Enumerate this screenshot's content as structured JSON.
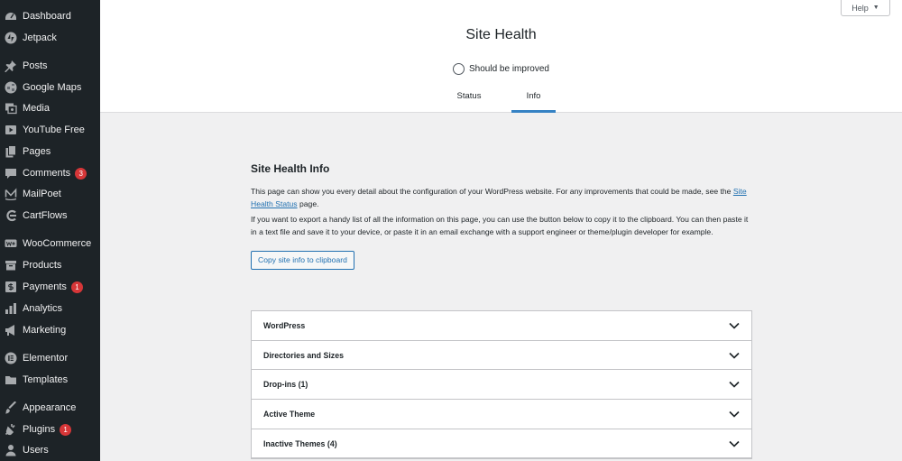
{
  "sidebar": {
    "items": [
      {
        "label": "Dashboard",
        "icon": "dashboard-icon",
        "badge": ""
      },
      {
        "label": "Jetpack",
        "icon": "jetpack-icon",
        "badge": ""
      },
      {
        "label": "Posts",
        "icon": "pin-icon",
        "badge": ""
      },
      {
        "label": "Google Maps",
        "icon": "map-icon",
        "badge": ""
      },
      {
        "label": "Media",
        "icon": "media-icon",
        "badge": ""
      },
      {
        "label": "YouTube Free",
        "icon": "youtube-icon",
        "badge": ""
      },
      {
        "label": "Pages",
        "icon": "page-icon",
        "badge": ""
      },
      {
        "label": "Comments",
        "icon": "comment-icon",
        "badge": "3"
      },
      {
        "label": "MailPoet",
        "icon": "mailpoet-icon",
        "badge": ""
      },
      {
        "label": "CartFlows",
        "icon": "cartflows-icon",
        "badge": ""
      },
      {
        "label": "WooCommerce",
        "icon": "woocommerce-icon",
        "badge": ""
      },
      {
        "label": "Products",
        "icon": "archive-icon",
        "badge": ""
      },
      {
        "label": "Payments",
        "icon": "money-icon",
        "badge": "1"
      },
      {
        "label": "Analytics",
        "icon": "chart-bar-icon",
        "badge": ""
      },
      {
        "label": "Marketing",
        "icon": "megaphone-icon",
        "badge": ""
      },
      {
        "label": "Elementor",
        "icon": "elementor-icon",
        "badge": ""
      },
      {
        "label": "Templates",
        "icon": "folder-icon",
        "badge": ""
      },
      {
        "label": "Appearance",
        "icon": "brush-icon",
        "badge": ""
      },
      {
        "label": "Plugins",
        "icon": "plug-icon",
        "badge": "1"
      },
      {
        "label": "Users",
        "icon": "user-icon",
        "badge": ""
      }
    ]
  },
  "header": {
    "title": "Site Health",
    "status": "Should be improved",
    "tabs": [
      "Status",
      "Info"
    ],
    "active_tab": "Info",
    "help": "Help"
  },
  "main": {
    "title": "Site Health Info",
    "para1_before": "This page can show you every detail about the configuration of your WordPress website. For any improvements that could be made, see the ",
    "para1_link": "Site Health Status",
    "para1_after": " page.",
    "para2": "If you want to export a handy list of all the information on this page, you can use the button below to copy it to the clipboard. You can then paste it in a text file and save it to your device, or paste it in an email exchange with a support engineer or theme/plugin developer for example.",
    "copy_button": "Copy site info to clipboard",
    "sections": [
      "WordPress",
      "Directories and Sizes",
      "Drop-ins (1)",
      "Active Theme",
      "Inactive Themes (4)"
    ]
  }
}
